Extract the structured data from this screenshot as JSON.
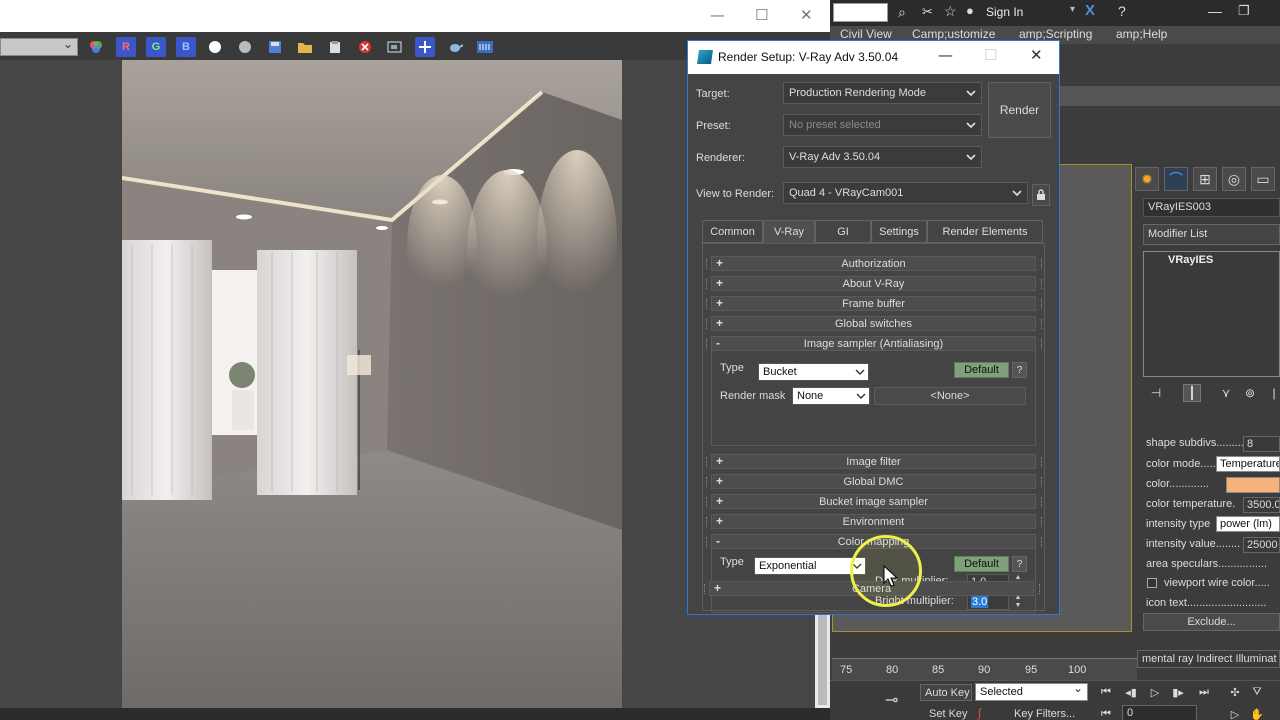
{
  "frame_buffer": {
    "channel_value": "",
    "toolbar_buttons": [
      "R",
      "G",
      "B"
    ]
  },
  "max_ui": {
    "sign_in": "Sign In",
    "menu": [
      "Civil View",
      "Camp;ustomize",
      "amp;Scripting",
      "amp;Help"
    ],
    "object_name": "VRayIES003",
    "modifier_list": "Modifier List",
    "stack_item": "VRayIES",
    "properties": [
      {
        "label": "shape subdivs.........",
        "value": "8"
      },
      {
        "label": "color mode.......",
        "value": "Temperature"
      },
      {
        "label": "color.............",
        "value": ""
      },
      {
        "label": "color temperature.",
        "value": "3500.0"
      },
      {
        "label": "intensity type",
        "value": "power (lm)"
      },
      {
        "label": "intensity value........",
        "value": "25000"
      },
      {
        "label": "area speculars................",
        "value": ""
      },
      {
        "label": "viewport wire color.....",
        "value": ""
      },
      {
        "label": "icon text..........................",
        "value": ""
      }
    ],
    "exclude_button": "Exclude...",
    "timeline_ticks": [
      "75",
      "80",
      "85",
      "90",
      "95",
      "100"
    ],
    "mental_ray_field": "mental ray Indirect Illuminat",
    "auto_key": "Auto Key",
    "set_key": "Set Key",
    "selected_dropdown": "Selected",
    "key_filters": "Key Filters...",
    "frame_value": "0",
    "light_color": "#f5b27a"
  },
  "dialog": {
    "title": "Render Setup: V-Ray Adv 3.50.04",
    "target_label": "Target:",
    "target_value": "Production Rendering Mode",
    "preset_label": "Preset:",
    "preset_value": "No preset selected",
    "renderer_label": "Renderer:",
    "renderer_value": "V-Ray Adv 3.50.04",
    "view_label": "View to Render:",
    "view_value": "Quad 4 - VRayCam001",
    "render_button": "Render",
    "tabs": [
      "Common",
      "V-Ray",
      "GI",
      "Settings",
      "Render Elements"
    ],
    "active_tab": "V-Ray",
    "rollouts_top": [
      {
        "sign": "+",
        "label": "Authorization"
      },
      {
        "sign": "+",
        "label": "About V-Ray"
      },
      {
        "sign": "+",
        "label": "Frame buffer"
      },
      {
        "sign": "+",
        "label": "Global switches"
      },
      {
        "sign": "-",
        "label": "Image sampler (Antialiasing)"
      }
    ],
    "image_sampler": {
      "type_label": "Type",
      "type_value": "Bucket",
      "default_button": "Default",
      "help_button": "?",
      "mask_label": "Render mask",
      "mask_value": "None",
      "mask_button": "<None>"
    },
    "rollouts_mid": [
      {
        "sign": "+",
        "label": "Image filter"
      },
      {
        "sign": "+",
        "label": "Global DMC"
      },
      {
        "sign": "+",
        "label": "Bucket image sampler"
      },
      {
        "sign": "+",
        "label": "Environment"
      },
      {
        "sign": "-",
        "label": "Color mapping"
      }
    ],
    "color_mapping": {
      "type_label": "Type",
      "type_value": "Exponential",
      "default_button": "Default",
      "help_button": "?",
      "dark_label": "Dark multiplier:",
      "dark_value": "1.0",
      "bright_label": "Bright multiplier:",
      "bright_value": "3.0"
    },
    "rollout_camera": {
      "sign": "+",
      "label": "Camera"
    }
  }
}
